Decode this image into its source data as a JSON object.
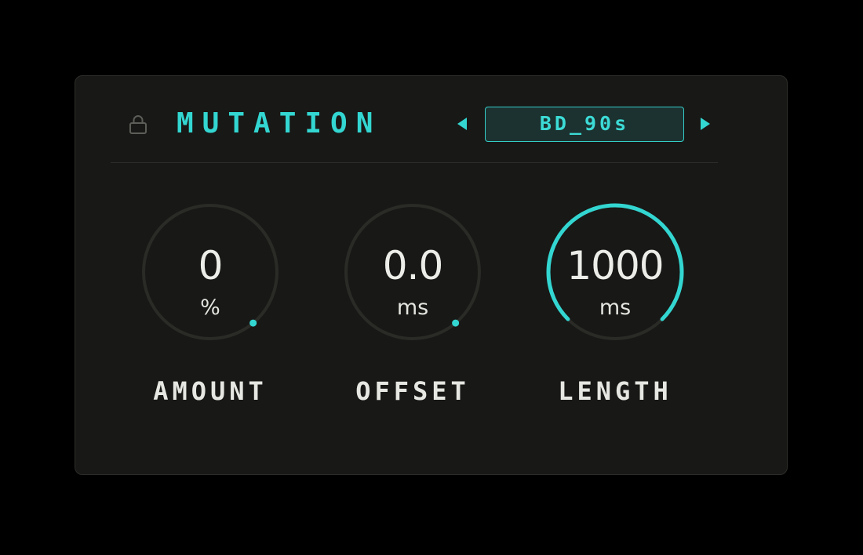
{
  "module": {
    "title": "MUTATION",
    "lock_icon": "lock-icon",
    "preset": {
      "name": "BD_90s",
      "prev_icon": "triangle-left-icon",
      "next_icon": "triangle-right-icon"
    }
  },
  "knobs": [
    {
      "id": "amount",
      "value": "0",
      "unit": "%",
      "label": "AMOUNT",
      "level": 0.0
    },
    {
      "id": "offset",
      "value": "0.0",
      "unit": "ms",
      "label": "OFFSET",
      "level": 0.0
    },
    {
      "id": "length",
      "value": "1000",
      "unit": "ms",
      "label": "LENGTH",
      "level": 1.0
    }
  ],
  "colors": {
    "accent": "#33d6d1",
    "background": "#000000",
    "panel": "#181816",
    "track": "#2a2a27",
    "text": "#ecece8"
  }
}
